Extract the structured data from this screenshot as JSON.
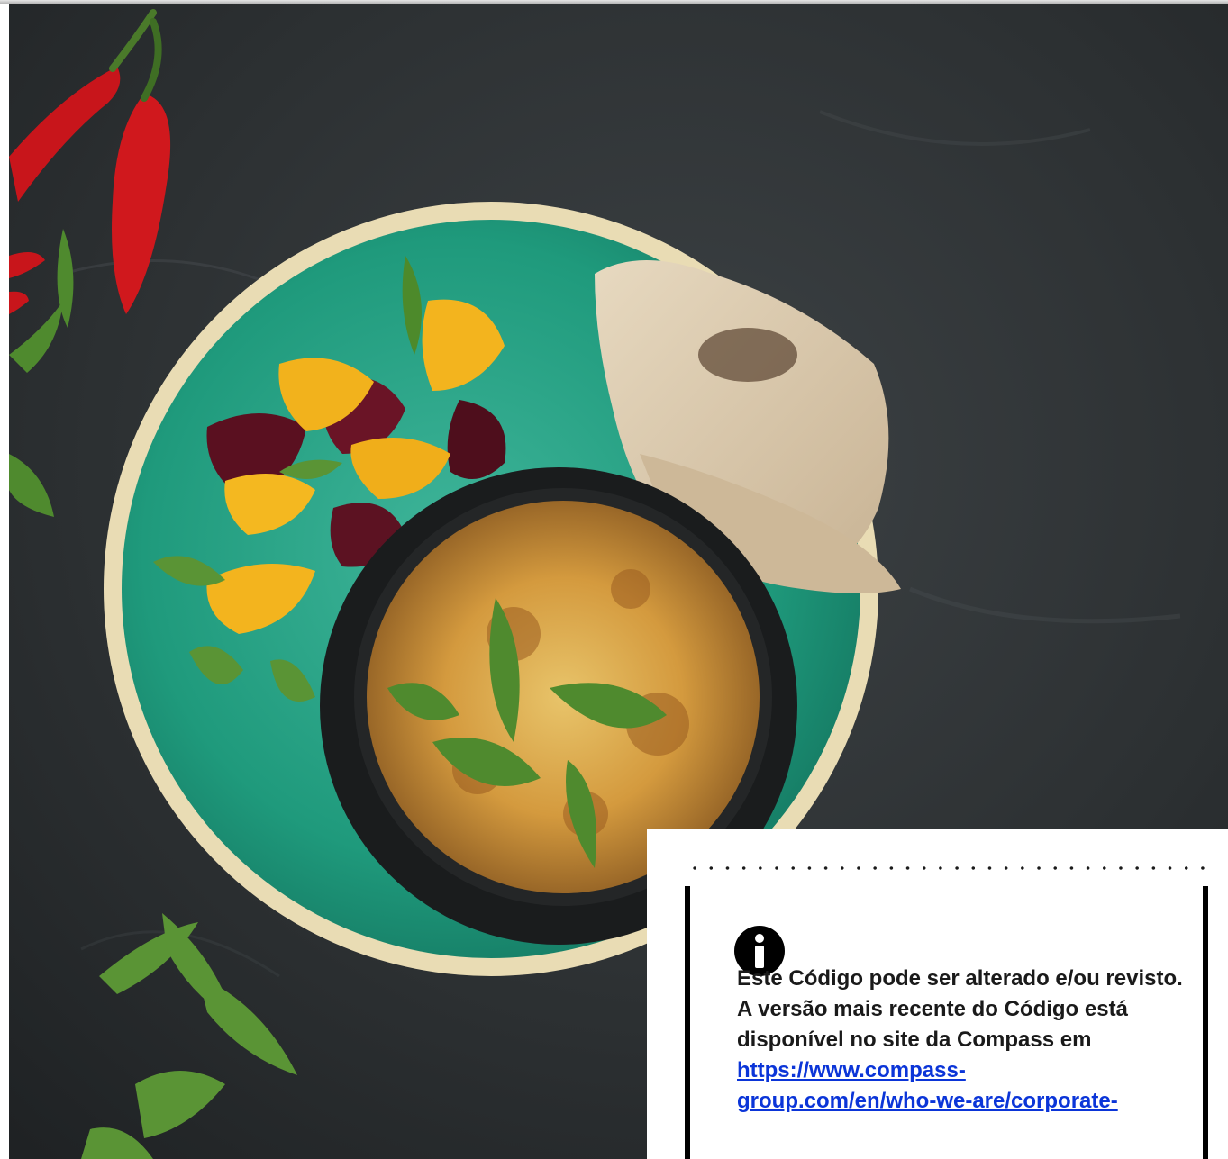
{
  "document": {
    "photo": {
      "subject": "food-photo"
    },
    "notice": {
      "icon": "info-icon",
      "text": "Este Código pode ser alterado e/ou revisto. A versão mais recente do Código está disponível no site da Compass  em",
      "link_line1": "https://www.compass-",
      "link_line2": "group.com/en/who-we-are/corporate-"
    },
    "colors": {
      "link": "#0b35d8",
      "text": "#1a1a1a",
      "frame": "#000000"
    }
  }
}
